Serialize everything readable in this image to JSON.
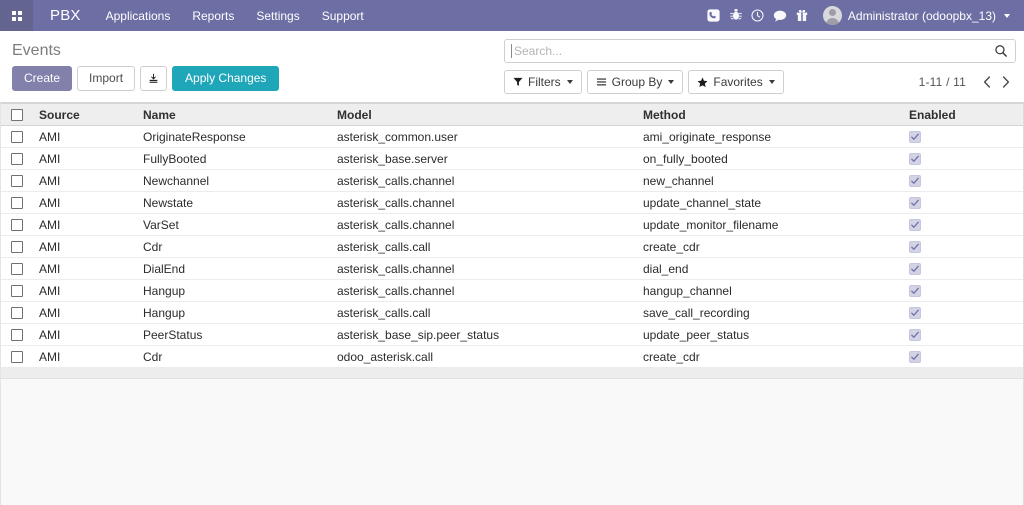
{
  "navbar": {
    "apps_icon": "apps-grid-icon",
    "brand": "PBX",
    "menu": [
      {
        "label": "Applications"
      },
      {
        "label": "Reports"
      },
      {
        "label": "Settings"
      },
      {
        "label": "Support"
      }
    ],
    "system_icons": [
      {
        "name": "phone-icon"
      },
      {
        "name": "bug-icon"
      },
      {
        "name": "clock-icon"
      },
      {
        "name": "chat-bubble-icon"
      },
      {
        "name": "gift-icon"
      }
    ],
    "user": {
      "name": "Administrator (odoopbx_13)",
      "avatar": "user-avatar-icon",
      "caret": "caret-down-icon"
    },
    "colors": {
      "background": "#6d6ea4",
      "apps_background": "#63648f",
      "text": "#ffffff"
    }
  },
  "control_panel": {
    "title": "Events",
    "buttons": {
      "create": "Create",
      "import": "Import",
      "download_icon": "download-icon",
      "apply_changes": "Apply Changes"
    },
    "colors": {
      "create": "#8181ab",
      "apply_changes": "#1fa6b8"
    },
    "search": {
      "placeholder": "Search...",
      "value": "",
      "icon": "search-icon"
    },
    "filters": [
      {
        "label": "Filters",
        "icon": "funnel-icon"
      },
      {
        "label": "Group By",
        "icon": "bars-icon"
      },
      {
        "label": "Favorites",
        "icon": "star-icon"
      }
    ],
    "pager": {
      "count": "1-11 / 11",
      "prev_icon": "chevron-left-icon",
      "next_icon": "chevron-right-icon"
    }
  },
  "table": {
    "select_all_checkbox": false,
    "columns": [
      {
        "key": "select",
        "label": ""
      },
      {
        "key": "source",
        "label": "Source"
      },
      {
        "key": "name",
        "label": "Name"
      },
      {
        "key": "model",
        "label": "Model"
      },
      {
        "key": "method",
        "label": "Method"
      },
      {
        "key": "enabled",
        "label": "Enabled"
      }
    ],
    "rows": [
      {
        "selected": false,
        "source": "AMI",
        "name": "OriginateResponse",
        "model": "asterisk_common.user",
        "method": "ami_originate_response",
        "enabled": true
      },
      {
        "selected": false,
        "source": "AMI",
        "name": "FullyBooted",
        "model": "asterisk_base.server",
        "method": "on_fully_booted",
        "enabled": true
      },
      {
        "selected": false,
        "source": "AMI",
        "name": "Newchannel",
        "model": "asterisk_calls.channel",
        "method": "new_channel",
        "enabled": true
      },
      {
        "selected": false,
        "source": "AMI",
        "name": "Newstate",
        "model": "asterisk_calls.channel",
        "method": "update_channel_state",
        "enabled": true
      },
      {
        "selected": false,
        "source": "AMI",
        "name": "VarSet",
        "model": "asterisk_calls.channel",
        "method": "update_monitor_filename",
        "enabled": true
      },
      {
        "selected": false,
        "source": "AMI",
        "name": "Cdr",
        "model": "asterisk_calls.call",
        "method": "create_cdr",
        "enabled": true
      },
      {
        "selected": false,
        "source": "AMI",
        "name": "DialEnd",
        "model": "asterisk_calls.channel",
        "method": "dial_end",
        "enabled": true
      },
      {
        "selected": false,
        "source": "AMI",
        "name": "Hangup",
        "model": "asterisk_calls.channel",
        "method": "hangup_channel",
        "enabled": true
      },
      {
        "selected": false,
        "source": "AMI",
        "name": "Hangup",
        "model": "asterisk_calls.call",
        "method": "save_call_recording",
        "enabled": true
      },
      {
        "selected": false,
        "source": "AMI",
        "name": "PeerStatus",
        "model": "asterisk_base_sip.peer_status",
        "method": "update_peer_status",
        "enabled": true
      },
      {
        "selected": false,
        "source": "AMI",
        "name": "Cdr",
        "model": "odoo_asterisk.call",
        "method": "create_cdr",
        "enabled": true
      }
    ]
  }
}
